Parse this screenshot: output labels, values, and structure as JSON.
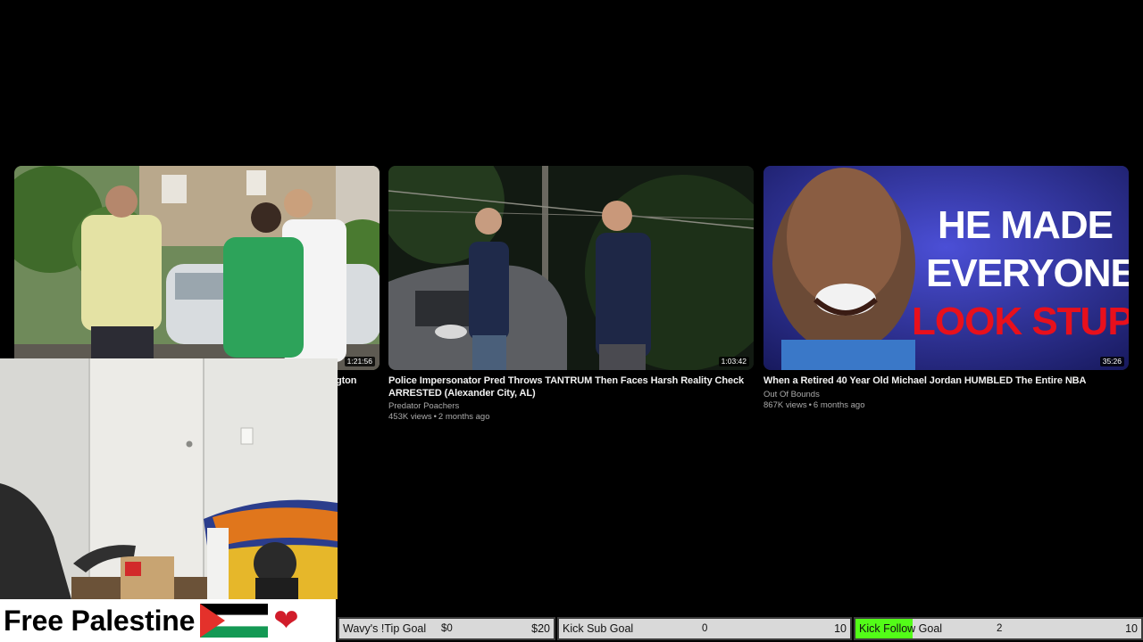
{
  "videos": [
    {
      "title": "gton",
      "channel": "",
      "views": "",
      "age": "",
      "duration": "1:21:56",
      "thumb_icon": "thumbnail-people-outdoors"
    },
    {
      "title": "Police Impersonator Pred Throws TANTRUM Then Faces Harsh Reality Check ARRESTED (Alexander City, AL)",
      "channel": "Predator Poachers",
      "views": "453K views",
      "age": "2 months ago",
      "duration": "1:03:42",
      "thumb_icon": "thumbnail-night-confrontation"
    },
    {
      "title": "When a Retired 40 Year Old Michael Jordan HUMBLED The Entire NBA",
      "channel": "Out Of Bounds",
      "views": "867K views",
      "age": "6 months ago",
      "duration": "35:26",
      "thumb_icon": "thumbnail-portrait",
      "thumb_text": [
        "HE MADE",
        "EVERYONE",
        "LOOK STUPID"
      ]
    }
  ],
  "meta_separator": "•",
  "banner": {
    "text": "Free Palestine",
    "flag_icon": "palestine-flag-icon",
    "heart_icon": "heart-icon",
    "heart_glyph": "❤"
  },
  "goals": [
    {
      "label": "Wavy's !Tip Goal",
      "current": "$0",
      "target": "$20",
      "progress": 0
    },
    {
      "label": "Kick Sub Goal",
      "current": "0",
      "target": "10",
      "progress": 0
    },
    {
      "label": "Kick Follow Goal",
      "current": "2",
      "target": "10",
      "progress": 0.2
    }
  ],
  "colors": {
    "background": "#000000",
    "goal_fill": "#53fc18",
    "thumb_text_white": "#ffffff",
    "thumb_text_red": "#e8101c",
    "heart": "#d11c2a"
  }
}
